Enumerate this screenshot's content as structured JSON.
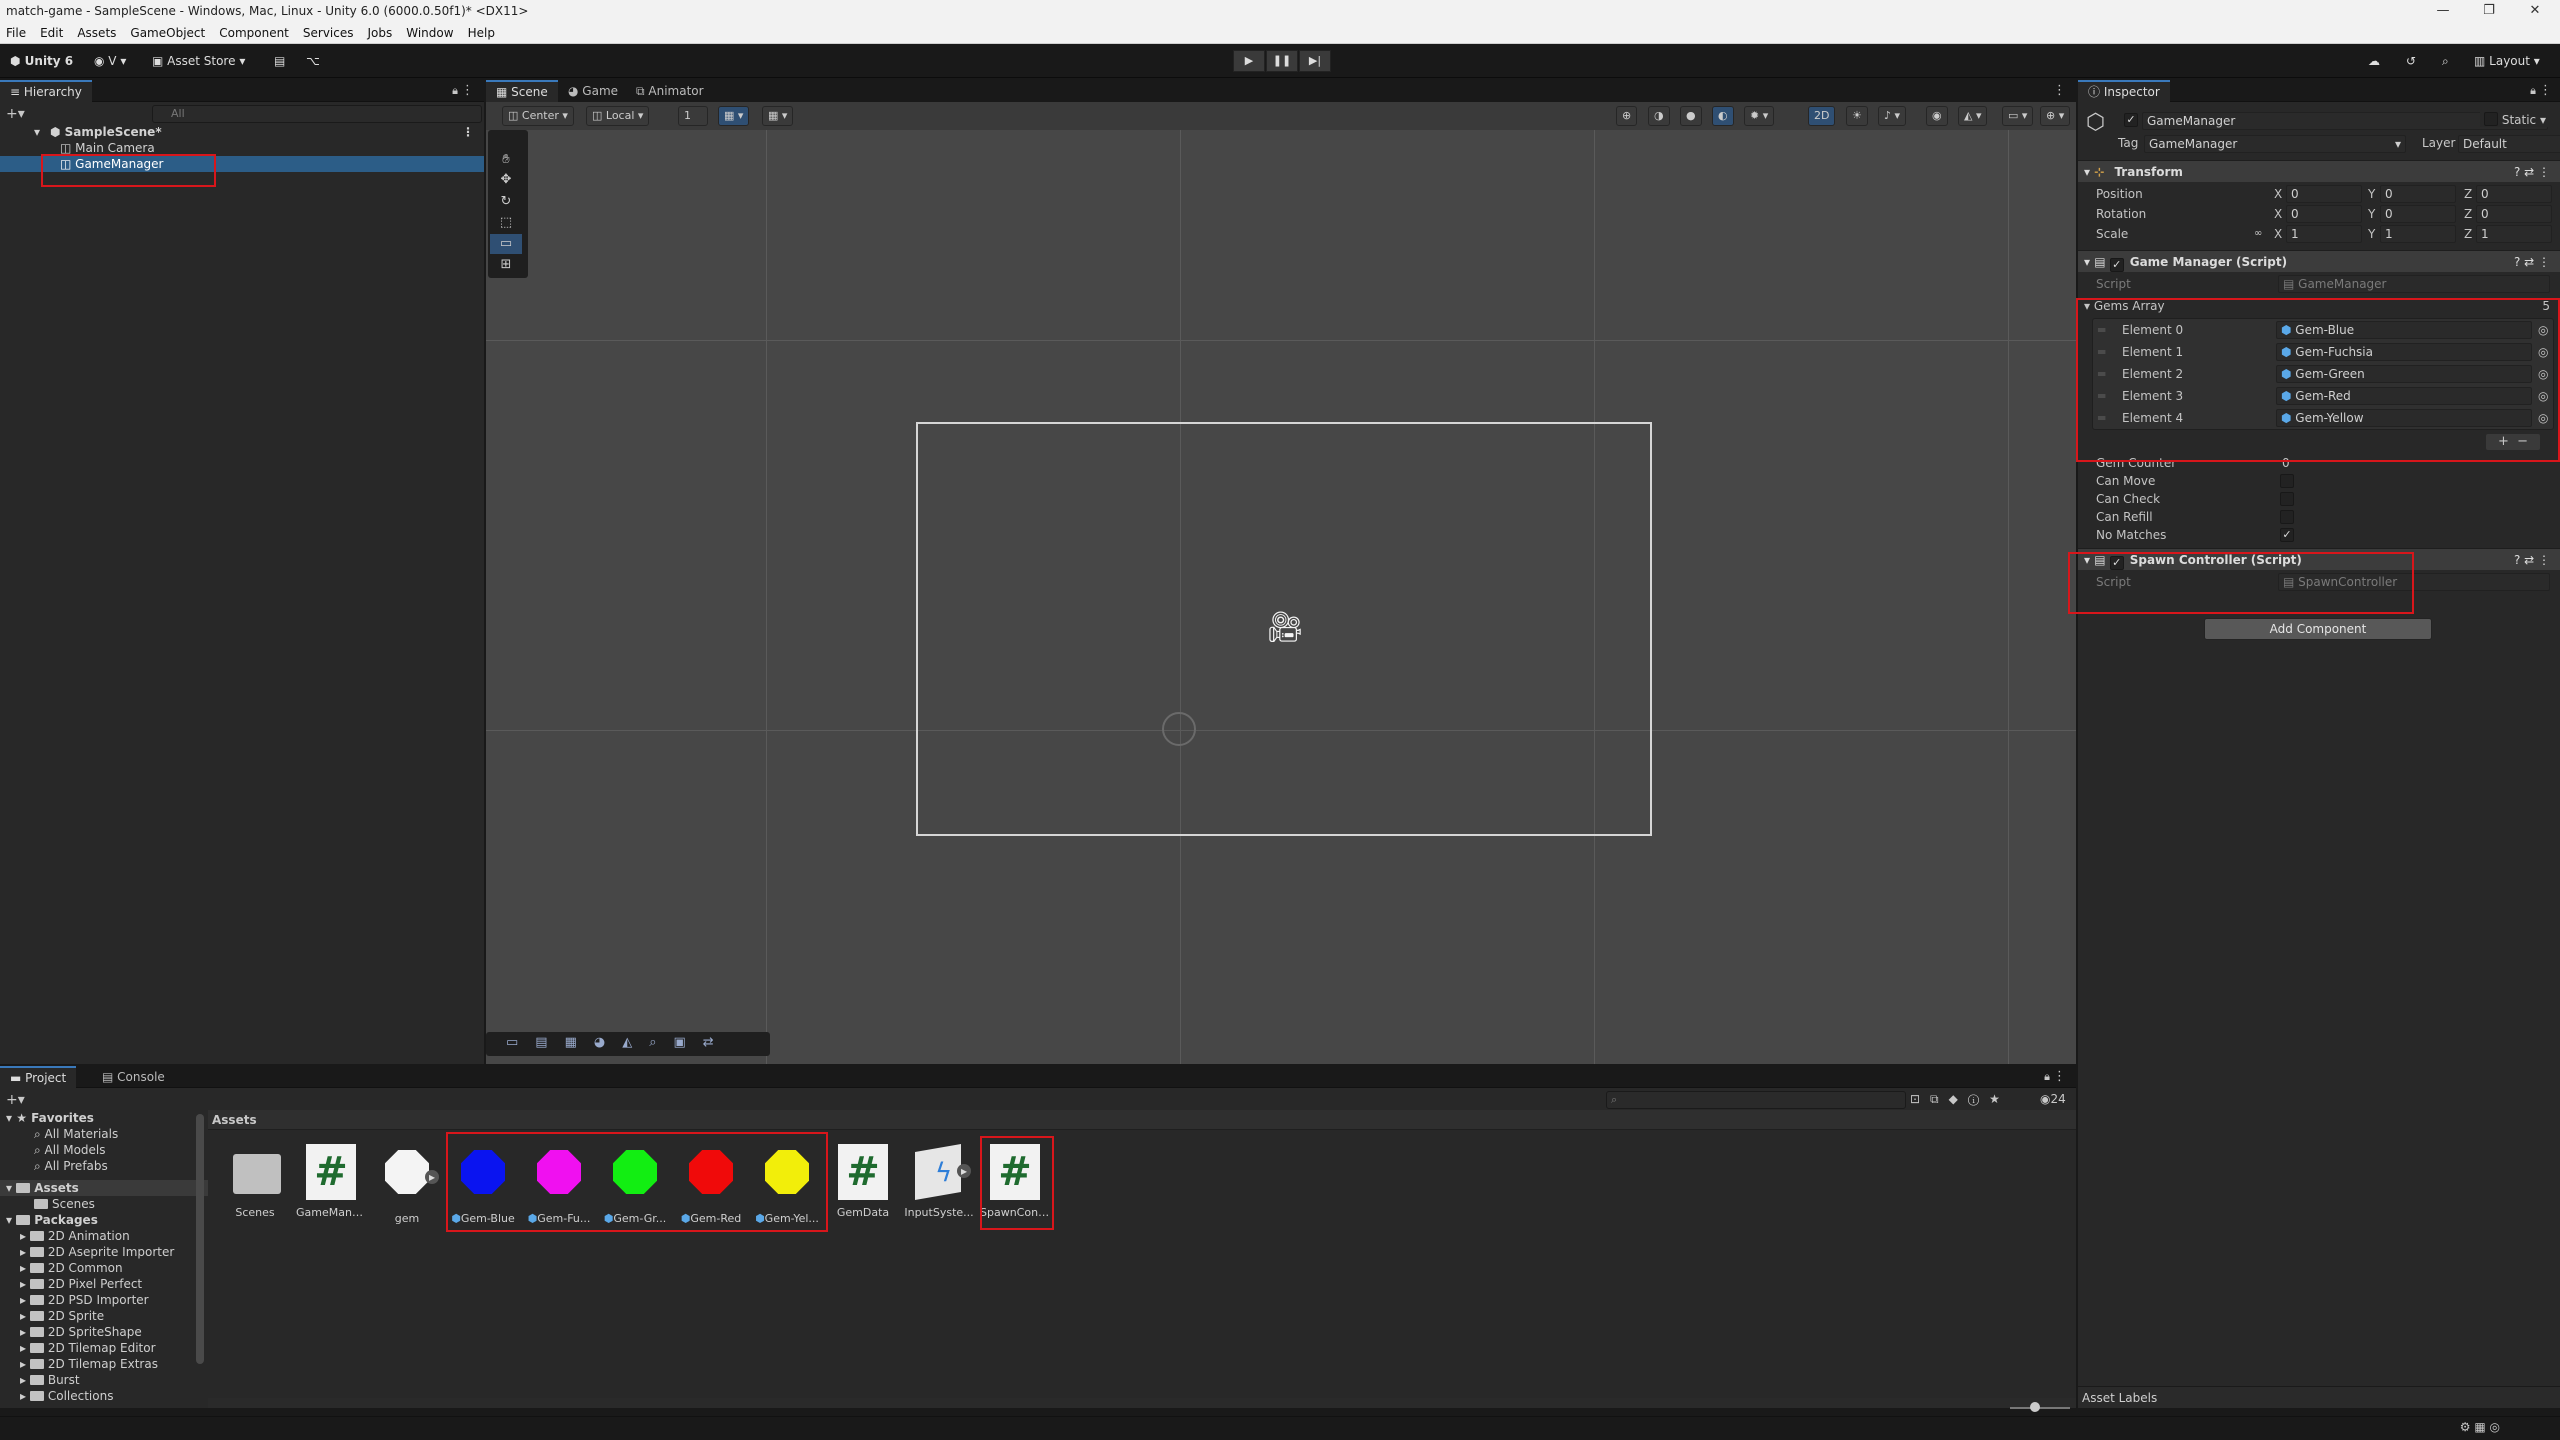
{
  "window": {
    "title": "match-game - SampleScene - Windows, Mac, Linux - Unity 6.0 (6000.0.50f1)* <DX11>"
  },
  "menu": [
    "File",
    "Edit",
    "Assets",
    "GameObject",
    "Component",
    "Services",
    "Jobs",
    "Window",
    "Help"
  ],
  "toolbar": {
    "unity_label": "Unity 6",
    "account_label": "V",
    "asset_store": "Asset Store",
    "layout": "Layout"
  },
  "hierarchy": {
    "tab": "Hierarchy",
    "search_placeholder": "All",
    "scene": "SampleScene*",
    "items": [
      "Main Camera",
      "GameManager"
    ]
  },
  "scene_view": {
    "tabs": [
      "Scene",
      "Game",
      "Animator"
    ],
    "pivot": "Center",
    "space": "Local",
    "snap": "1",
    "mode_2d": "2D"
  },
  "inspector": {
    "tab": "Inspector",
    "object_name": "GameManager",
    "static_label": "Static",
    "tag_label": "Tag",
    "tag_value": "GameManager",
    "layer_label": "Layer",
    "layer_value": "Default",
    "transform": {
      "title": "Transform",
      "rows": [
        {
          "label": "Position",
          "x": "0",
          "y": "0",
          "z": "0"
        },
        {
          "label": "Rotation",
          "x": "0",
          "y": "0",
          "z": "0"
        },
        {
          "label": "Scale",
          "x": "1",
          "y": "1",
          "z": "1"
        }
      ]
    },
    "game_manager": {
      "title": "Game Manager (Script)",
      "script_label": "Script",
      "script_value": "GameManager",
      "array_label": "Gems Array",
      "array_size": "5",
      "elements": [
        {
          "label": "Element 0",
          "value": "Gem-Blue"
        },
        {
          "label": "Element 1",
          "value": "Gem-Fuchsia"
        },
        {
          "label": "Element 2",
          "value": "Gem-Green"
        },
        {
          "label": "Element 3",
          "value": "Gem-Red"
        },
        {
          "label": "Element 4",
          "value": "Gem-Yellow"
        }
      ],
      "fields": [
        {
          "label": "Gem Counter",
          "value": "0"
        },
        {
          "label": "Can Move",
          "value": ""
        },
        {
          "label": "Can Check",
          "value": ""
        },
        {
          "label": "Can Refill",
          "value": ""
        },
        {
          "label": "No Matches",
          "value": "✓"
        }
      ]
    },
    "spawn_controller": {
      "title": "Spawn Controller (Script)",
      "script_label": "Script",
      "script_value": "SpawnController"
    },
    "add_component": "Add Component",
    "asset_labels": "Asset Labels"
  },
  "project": {
    "tabs": [
      "Project",
      "Console"
    ],
    "breadcrumb": "Assets",
    "hidden_count": "24",
    "favorites_label": "Favorites",
    "favorites": [
      "All Materials",
      "All Models",
      "All Prefabs"
    ],
    "assets_label": "Assets",
    "assets_children": [
      "Scenes"
    ],
    "packages_label": "Packages",
    "packages": [
      "2D Animation",
      "2D Aseprite Importer",
      "2D Common",
      "2D Pixel Perfect",
      "2D PSD Importer",
      "2D Sprite",
      "2D SpriteShape",
      "2D Tilemap Editor",
      "2D Tilemap Extras",
      "Burst",
      "Collections"
    ],
    "grid_items": [
      {
        "label": "Scenes",
        "kind": "folder"
      },
      {
        "label": "GameMana...",
        "kind": "script"
      },
      {
        "label": "gem",
        "kind": "sprite"
      },
      {
        "label": "Gem-Blue",
        "kind": "prefab",
        "color": "#0a14f0"
      },
      {
        "label": "Gem-Fu...",
        "kind": "prefab",
        "color": "#f010f0"
      },
      {
        "label": "Gem-Gr...",
        "kind": "prefab",
        "color": "#12ee12"
      },
      {
        "label": "Gem-Red",
        "kind": "prefab",
        "color": "#f00a0a"
      },
      {
        "label": "Gem-Yel...",
        "kind": "prefab",
        "color": "#f2ee0a"
      },
      {
        "label": "GemData",
        "kind": "script"
      },
      {
        "label": "InputSyste...",
        "kind": "input"
      },
      {
        "label": "SpawnCont...",
        "kind": "script"
      }
    ]
  },
  "colors": {
    "selection": "#2c5d87",
    "accent": "#3a79bb",
    "highlight_box": "#d8161b"
  }
}
